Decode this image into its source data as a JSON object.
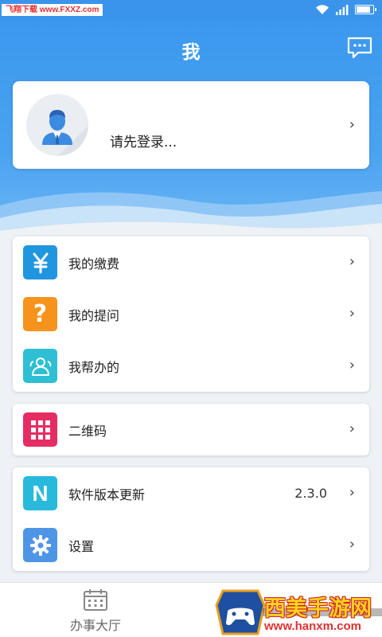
{
  "status_bar": {
    "watermark": "飞翔下载 www.FXXZ.com"
  },
  "header": {
    "title": "我"
  },
  "profile": {
    "login_prompt": "请先登录..."
  },
  "menu_group_1": [
    {
      "label": "我的缴费",
      "icon": "yuan-icon",
      "color": "#2196e0"
    },
    {
      "label": "我的提问",
      "icon": "question-icon",
      "color": "#f5931c"
    },
    {
      "label": "我帮办的",
      "icon": "users-icon",
      "color": "#2ebfd4"
    }
  ],
  "menu_group_2": [
    {
      "label": "二维码",
      "icon": "grid-icon",
      "color": "#e52d64"
    }
  ],
  "menu_group_3": [
    {
      "label": "软件版本更新",
      "icon": "n-icon",
      "color": "#29b9dd",
      "value": "2.3.0"
    },
    {
      "label": "设置",
      "icon": "gear-icon",
      "color": "#4f95e6"
    }
  ],
  "tabbar": {
    "tabs": [
      {
        "label": "办事大厅",
        "icon": "calendar-icon"
      }
    ]
  },
  "watermark_bottom": {
    "text": "西美手游网",
    "url": "www.hanxm.com"
  }
}
